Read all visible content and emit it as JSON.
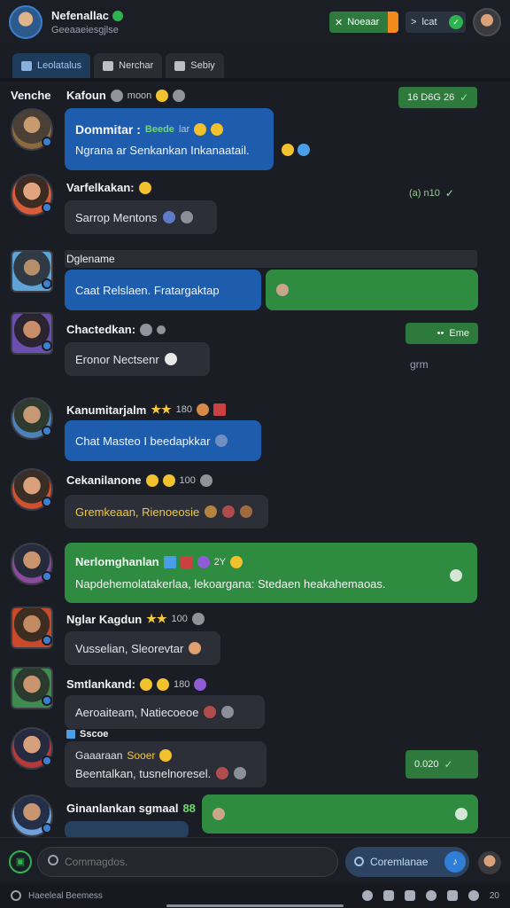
{
  "header": {
    "title": "Nefenallac",
    "subtitle": "Geeaaeiesgjlse",
    "moderator_label": "Noeaar",
    "share_label": "lcat"
  },
  "tabs": [
    {
      "label": "Leolatalus"
    },
    {
      "label": "Nerchar"
    },
    {
      "label": "Sebiy"
    }
  ],
  "chat": {
    "top_left_name": "Venche",
    "top_sender": "Kafoun",
    "top_sender_meta": "moon",
    "top_chip": "16 D6G 26",
    "messages": [
      {
        "name": "Dommitar :",
        "badge": "Beede",
        "meta": "lar",
        "text": "Ngrana ar Senkankan Inkanaatail."
      },
      {
        "name": "Varfelkakan:",
        "text": "Sarrop Mentons"
      },
      {
        "name": "Dglename",
        "text": "Caat Relslaen. Fratargaktap"
      },
      {
        "name": "Chactedkan:",
        "text": "Eronor Nectsenr"
      },
      {
        "name": "Kanumitarjalm",
        "meta": "180",
        "text": "Chat Masteo I beedapkkar"
      },
      {
        "name": "Cekanilanone",
        "meta": "100",
        "text": "Gremkeaan, Rienoeosie"
      },
      {
        "name": "Nerlomghanlan",
        "meta": "2Y",
        "text": "Napdehemolatakerlaa, lekoargana: Stedaen heakahemaoas."
      },
      {
        "name": "Nglar Kagdun",
        "meta": "100",
        "text": "Vusselian, Sleorevtar"
      },
      {
        "name": "Smtlankand:",
        "meta": "180",
        "text": "Aeroaiteam, Natiecoeoe"
      },
      {
        "name": "Sscoe",
        "meta": "Sooer",
        "text_prefix": "Gaaaraan",
        "text": "Beentalkan, tusnelnoresel."
      },
      {
        "name": "Ginanlankan sgmaal",
        "meta": "88",
        "text": ""
      }
    ],
    "side_chip_1": "(a) n10",
    "side_chip_2": "Eme",
    "side_label": "grm",
    "side_chip_3": "0.020"
  },
  "composer": {
    "placeholder": "Commagdos.",
    "send_label": "Coremlanae"
  },
  "footer": {
    "status": "Haeeleal Beemess",
    "count": "20"
  },
  "colors": {
    "background": "#1b1d24",
    "blue_bubble": "#1e5cae",
    "green_bubble": "#2e8b3f",
    "dark_bubble": "#2c2f37",
    "accent_orange": "#f48a1b"
  }
}
